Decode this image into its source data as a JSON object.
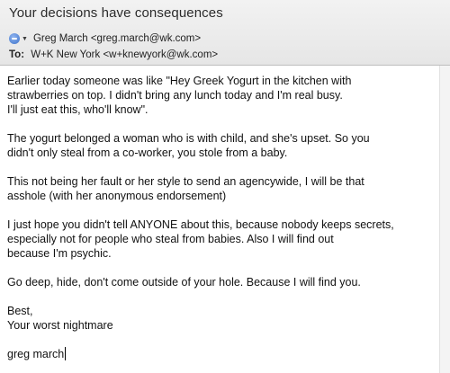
{
  "message": {
    "subject": "Your decisions have consequences",
    "from": "Greg March <greg.march@wk.com>",
    "to_label": "To:",
    "to": "W+K New York <w+knewyork@wk.com>",
    "from_icon": "person-icon",
    "paragraphs": [
      "Earlier today someone was like \"Hey Greek Yogurt in the kitchen with\nstrawberries on top.  I didn't bring any lunch today and I'm real busy.\nI'll just eat this, who'll know\".",
      "The yogurt belonged a woman who is with child, and she's upset.  So you\ndidn't only steal from a co-worker, you stole from a baby.",
      "This not being her fault or her style to send an agencywide, I will be that\nasshole (with her anonymous endorsement)",
      "I just hope you didn't tell ANYONE about this, because nobody keeps secrets,\nespecially not for people who steal from babies.  Also I will find out\nbecause I'm psychic.",
      "Go deep, hide, don't come outside of your hole.  Because I will find you.",
      "Best,\nYour worst nightmare"
    ],
    "signature": "greg march"
  }
}
